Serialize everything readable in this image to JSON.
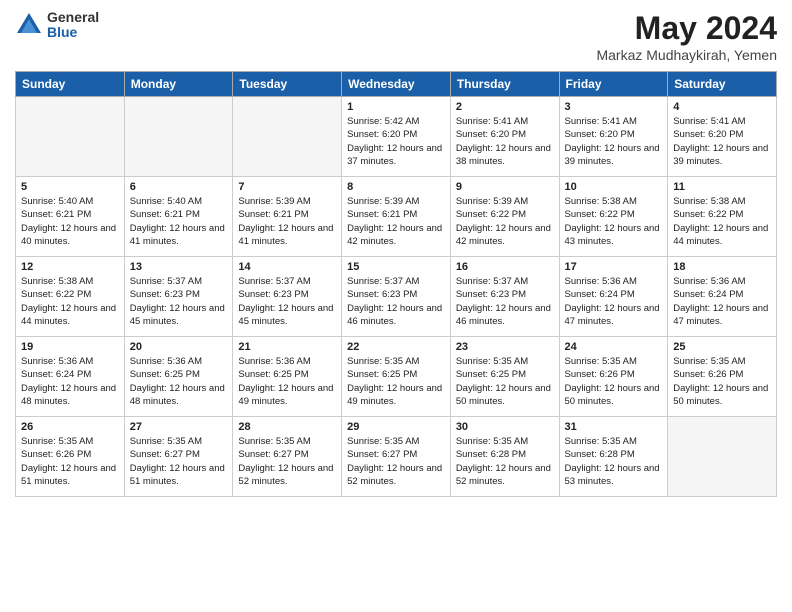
{
  "logo": {
    "general": "General",
    "blue": "Blue"
  },
  "title": {
    "month_year": "May 2024",
    "location": "Markaz Mudhaykirah, Yemen"
  },
  "weekdays": [
    "Sunday",
    "Monday",
    "Tuesday",
    "Wednesday",
    "Thursday",
    "Friday",
    "Saturday"
  ],
  "weeks": [
    [
      {
        "day": "",
        "sunrise": "",
        "sunset": "",
        "daylight": ""
      },
      {
        "day": "",
        "sunrise": "",
        "sunset": "",
        "daylight": ""
      },
      {
        "day": "",
        "sunrise": "",
        "sunset": "",
        "daylight": ""
      },
      {
        "day": "1",
        "sunrise": "Sunrise: 5:42 AM",
        "sunset": "Sunset: 6:20 PM",
        "daylight": "Daylight: 12 hours and 37 minutes."
      },
      {
        "day": "2",
        "sunrise": "Sunrise: 5:41 AM",
        "sunset": "Sunset: 6:20 PM",
        "daylight": "Daylight: 12 hours and 38 minutes."
      },
      {
        "day": "3",
        "sunrise": "Sunrise: 5:41 AM",
        "sunset": "Sunset: 6:20 PM",
        "daylight": "Daylight: 12 hours and 39 minutes."
      },
      {
        "day": "4",
        "sunrise": "Sunrise: 5:41 AM",
        "sunset": "Sunset: 6:20 PM",
        "daylight": "Daylight: 12 hours and 39 minutes."
      }
    ],
    [
      {
        "day": "5",
        "sunrise": "Sunrise: 5:40 AM",
        "sunset": "Sunset: 6:21 PM",
        "daylight": "Daylight: 12 hours and 40 minutes."
      },
      {
        "day": "6",
        "sunrise": "Sunrise: 5:40 AM",
        "sunset": "Sunset: 6:21 PM",
        "daylight": "Daylight: 12 hours and 41 minutes."
      },
      {
        "day": "7",
        "sunrise": "Sunrise: 5:39 AM",
        "sunset": "Sunset: 6:21 PM",
        "daylight": "Daylight: 12 hours and 41 minutes."
      },
      {
        "day": "8",
        "sunrise": "Sunrise: 5:39 AM",
        "sunset": "Sunset: 6:21 PM",
        "daylight": "Daylight: 12 hours and 42 minutes."
      },
      {
        "day": "9",
        "sunrise": "Sunrise: 5:39 AM",
        "sunset": "Sunset: 6:22 PM",
        "daylight": "Daylight: 12 hours and 42 minutes."
      },
      {
        "day": "10",
        "sunrise": "Sunrise: 5:38 AM",
        "sunset": "Sunset: 6:22 PM",
        "daylight": "Daylight: 12 hours and 43 minutes."
      },
      {
        "day": "11",
        "sunrise": "Sunrise: 5:38 AM",
        "sunset": "Sunset: 6:22 PM",
        "daylight": "Daylight: 12 hours and 44 minutes."
      }
    ],
    [
      {
        "day": "12",
        "sunrise": "Sunrise: 5:38 AM",
        "sunset": "Sunset: 6:22 PM",
        "daylight": "Daylight: 12 hours and 44 minutes."
      },
      {
        "day": "13",
        "sunrise": "Sunrise: 5:37 AM",
        "sunset": "Sunset: 6:23 PM",
        "daylight": "Daylight: 12 hours and 45 minutes."
      },
      {
        "day": "14",
        "sunrise": "Sunrise: 5:37 AM",
        "sunset": "Sunset: 6:23 PM",
        "daylight": "Daylight: 12 hours and 45 minutes."
      },
      {
        "day": "15",
        "sunrise": "Sunrise: 5:37 AM",
        "sunset": "Sunset: 6:23 PM",
        "daylight": "Daylight: 12 hours and 46 minutes."
      },
      {
        "day": "16",
        "sunrise": "Sunrise: 5:37 AM",
        "sunset": "Sunset: 6:23 PM",
        "daylight": "Daylight: 12 hours and 46 minutes."
      },
      {
        "day": "17",
        "sunrise": "Sunrise: 5:36 AM",
        "sunset": "Sunset: 6:24 PM",
        "daylight": "Daylight: 12 hours and 47 minutes."
      },
      {
        "day": "18",
        "sunrise": "Sunrise: 5:36 AM",
        "sunset": "Sunset: 6:24 PM",
        "daylight": "Daylight: 12 hours and 47 minutes."
      }
    ],
    [
      {
        "day": "19",
        "sunrise": "Sunrise: 5:36 AM",
        "sunset": "Sunset: 6:24 PM",
        "daylight": "Daylight: 12 hours and 48 minutes."
      },
      {
        "day": "20",
        "sunrise": "Sunrise: 5:36 AM",
        "sunset": "Sunset: 6:25 PM",
        "daylight": "Daylight: 12 hours and 48 minutes."
      },
      {
        "day": "21",
        "sunrise": "Sunrise: 5:36 AM",
        "sunset": "Sunset: 6:25 PM",
        "daylight": "Daylight: 12 hours and 49 minutes."
      },
      {
        "day": "22",
        "sunrise": "Sunrise: 5:35 AM",
        "sunset": "Sunset: 6:25 PM",
        "daylight": "Daylight: 12 hours and 49 minutes."
      },
      {
        "day": "23",
        "sunrise": "Sunrise: 5:35 AM",
        "sunset": "Sunset: 6:25 PM",
        "daylight": "Daylight: 12 hours and 50 minutes."
      },
      {
        "day": "24",
        "sunrise": "Sunrise: 5:35 AM",
        "sunset": "Sunset: 6:26 PM",
        "daylight": "Daylight: 12 hours and 50 minutes."
      },
      {
        "day": "25",
        "sunrise": "Sunrise: 5:35 AM",
        "sunset": "Sunset: 6:26 PM",
        "daylight": "Daylight: 12 hours and 50 minutes."
      }
    ],
    [
      {
        "day": "26",
        "sunrise": "Sunrise: 5:35 AM",
        "sunset": "Sunset: 6:26 PM",
        "daylight": "Daylight: 12 hours and 51 minutes."
      },
      {
        "day": "27",
        "sunrise": "Sunrise: 5:35 AM",
        "sunset": "Sunset: 6:27 PM",
        "daylight": "Daylight: 12 hours and 51 minutes."
      },
      {
        "day": "28",
        "sunrise": "Sunrise: 5:35 AM",
        "sunset": "Sunset: 6:27 PM",
        "daylight": "Daylight: 12 hours and 52 minutes."
      },
      {
        "day": "29",
        "sunrise": "Sunrise: 5:35 AM",
        "sunset": "Sunset: 6:27 PM",
        "daylight": "Daylight: 12 hours and 52 minutes."
      },
      {
        "day": "30",
        "sunrise": "Sunrise: 5:35 AM",
        "sunset": "Sunset: 6:28 PM",
        "daylight": "Daylight: 12 hours and 52 minutes."
      },
      {
        "day": "31",
        "sunrise": "Sunrise: 5:35 AM",
        "sunset": "Sunset: 6:28 PM",
        "daylight": "Daylight: 12 hours and 53 minutes."
      },
      {
        "day": "",
        "sunrise": "",
        "sunset": "",
        "daylight": ""
      }
    ]
  ]
}
